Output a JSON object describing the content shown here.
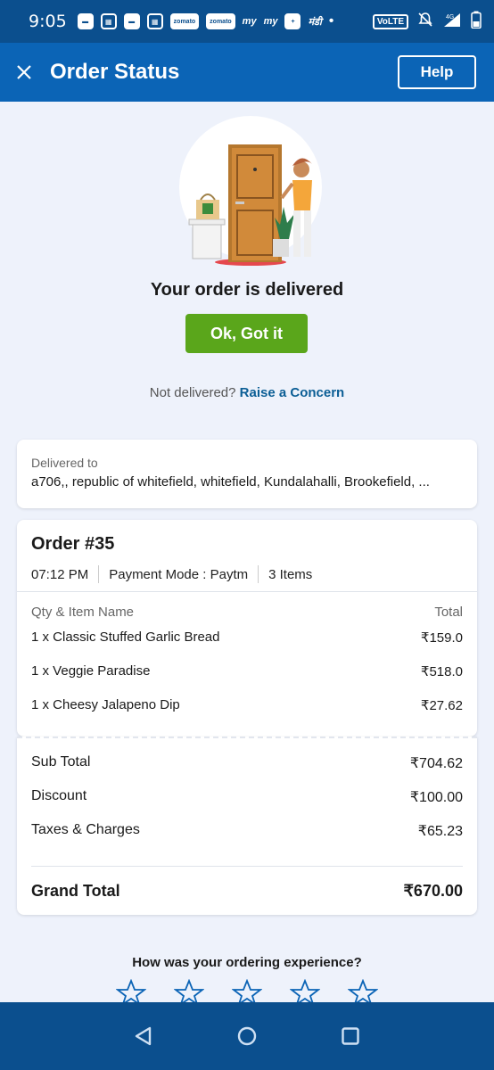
{
  "status_bar": {
    "time": "9:05",
    "app_icons": [
      "message-icon",
      "calculator-icon",
      "message-icon",
      "calculator-icon",
      "zomato-icon",
      "zomato-icon",
      "my-app-icon",
      "my-app-icon",
      "pharmacy-icon",
      "mandi-icon"
    ],
    "zomato_label": "zomato",
    "my_label": "my",
    "mandi_label": "मंडी",
    "volte": "VoLTE",
    "network": "4G"
  },
  "app_bar": {
    "title": "Order Status",
    "help_label": "Help"
  },
  "delivery": {
    "message": "Your order is delivered",
    "ok_label": "Ok, Got it",
    "not_delivered": "Not delivered?",
    "concern_label": "Raise a Concern"
  },
  "address": {
    "label": "Delivered to",
    "value": "a706,, republic of whitefield, whitefield, Kundalahalli, Brookefield, ..."
  },
  "order": {
    "title": "Order #35",
    "time": "07:12 PM",
    "payment": "Payment Mode : Paytm",
    "item_count": "3 Items",
    "col_item": "Qty & Item Name",
    "col_total": "Total",
    "items": [
      {
        "name": "1 x Classic Stuffed Garlic Bread",
        "total": "₹159.0"
      },
      {
        "name": "1 x Veggie Paradise",
        "total": "₹518.0"
      },
      {
        "name": "1 x Cheesy Jalapeno Dip",
        "total": "₹27.62"
      }
    ]
  },
  "totals": {
    "rows": [
      {
        "label": "Sub Total",
        "value": "₹704.62"
      },
      {
        "label": "Discount",
        "value": "₹100.00"
      },
      {
        "label": "Taxes & Charges",
        "value": "₹65.23"
      }
    ],
    "grand_label": "Grand Total",
    "grand_value": "₹670.00"
  },
  "feedback": {
    "question": "How was your ordering experience?",
    "star_count": 5
  },
  "colors": {
    "status_bar": "#0b4f8e",
    "app_bar": "#0b64b6",
    "ok_button": "#5aa61b",
    "link": "#0b5e95",
    "star": "#0b64b6"
  }
}
